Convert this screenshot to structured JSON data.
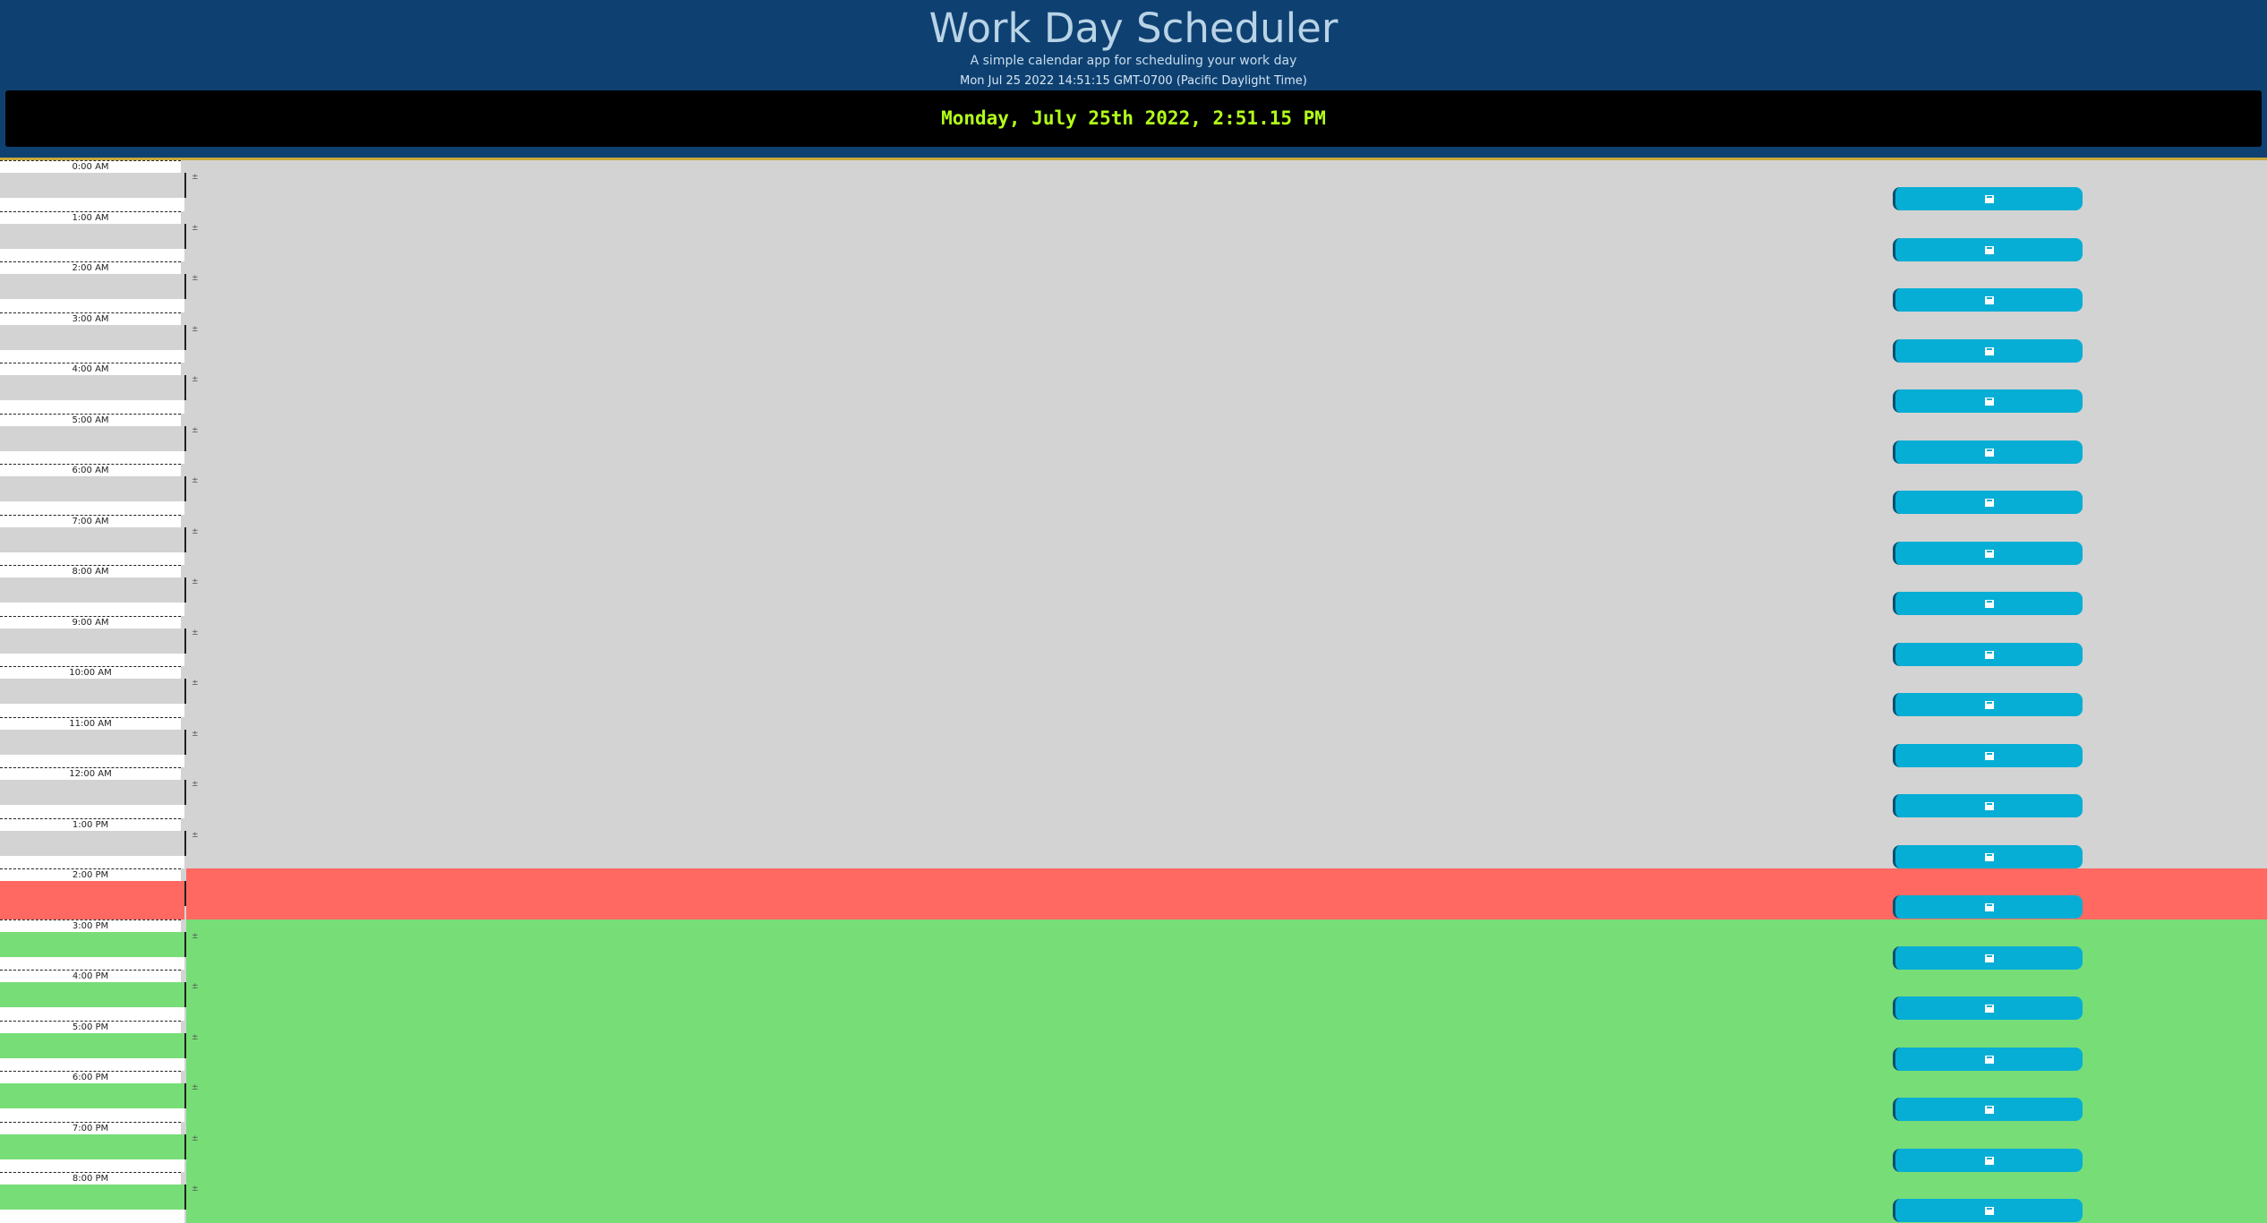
{
  "header": {
    "title": "Work Day Scheduler",
    "subtitle": "A simple calendar app for scheduling your work day",
    "date_string": "Mon Jul 25 2022 14:51:15 GMT-0700 (Pacific Daylight Time)",
    "clock": "Monday, July 25th 2022, 2:51.15 PM"
  },
  "colors": {
    "header_bg": "#0e4172",
    "clock_text": "#b3ff1a",
    "past": "#d3d3d3",
    "present": "#ff6961",
    "future": "#77dd77",
    "save_button": "#06aed5"
  },
  "hours": [
    {
      "label": "0:00 AM",
      "state": "past",
      "icon": "save-icon"
    },
    {
      "label": "1:00 AM",
      "state": "past",
      "icon": "save-icon"
    },
    {
      "label": "2:00 AM",
      "state": "past",
      "icon": "save-icon"
    },
    {
      "label": "3:00 AM",
      "state": "past",
      "icon": "save-icon"
    },
    {
      "label": "4:00 AM",
      "state": "past",
      "icon": "save-icon"
    },
    {
      "label": "5:00 AM",
      "state": "past",
      "icon": "save-icon"
    },
    {
      "label": "6:00 AM",
      "state": "past",
      "icon": "save-icon"
    },
    {
      "label": "7:00 AM",
      "state": "past",
      "icon": "save-icon"
    },
    {
      "label": "8:00 AM",
      "state": "past",
      "icon": "save-icon"
    },
    {
      "label": "9:00 AM",
      "state": "past",
      "icon": "save-icon"
    },
    {
      "label": "10:00 AM",
      "state": "past",
      "icon": "save-icon"
    },
    {
      "label": "11:00 AM",
      "state": "past",
      "icon": "save-icon"
    },
    {
      "label": "12:00 AM",
      "state": "past",
      "icon": "save-icon"
    },
    {
      "label": "1:00 PM",
      "state": "past",
      "icon": "save-icon"
    },
    {
      "label": "2:00 PM",
      "state": "present",
      "icon": "save-icon"
    },
    {
      "label": "3:00 PM",
      "state": "future",
      "icon": "save-icon"
    },
    {
      "label": "4:00 PM",
      "state": "future",
      "icon": "save-icon"
    },
    {
      "label": "5:00 PM",
      "state": "future",
      "icon": "save-icon"
    },
    {
      "label": "6:00 PM",
      "state": "future",
      "icon": "save-icon"
    },
    {
      "label": "7:00 PM",
      "state": "future",
      "icon": "save-icon"
    },
    {
      "label": "8:00 PM",
      "state": "future",
      "icon": "save-icon"
    }
  ]
}
